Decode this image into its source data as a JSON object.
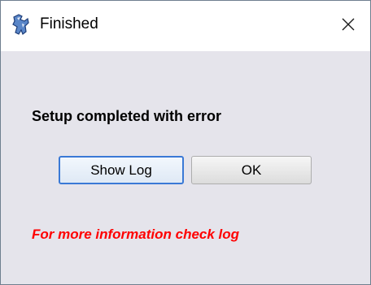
{
  "window": {
    "title": "Finished",
    "icon": "setup-wizard-icon",
    "close_icon": "close-icon"
  },
  "dialog": {
    "message": "Setup completed with error",
    "show_log_label": "Show Log",
    "ok_label": "OK",
    "footnote": "For more information check log",
    "footnote_color": "#ff0000",
    "focused_button": "Show Log"
  }
}
